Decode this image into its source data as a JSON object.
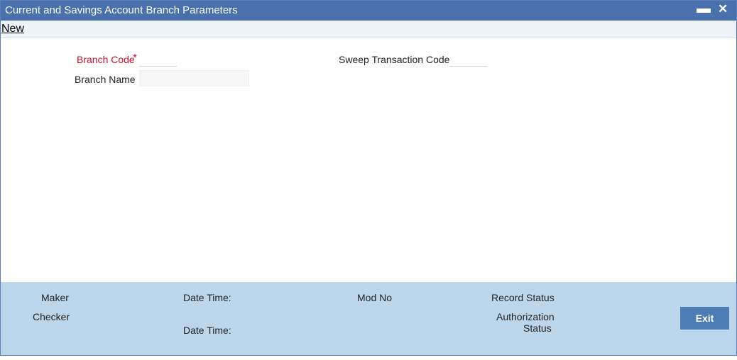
{
  "window": {
    "title": "Current and Savings Account Branch Parameters",
    "minimize_glyph": "▬",
    "close_glyph": "✕"
  },
  "toolbar": {
    "new_label": "New"
  },
  "form": {
    "branch_code_label": "Branch Code",
    "required_mark": "*",
    "branch_code_value": "",
    "branch_name_label": "Branch Name",
    "branch_name_value": "",
    "sweep_label": "Sweep Transaction Code",
    "sweep_value": ""
  },
  "footer": {
    "maker": "Maker",
    "checker": "Checker",
    "date_time_1": "Date Time:",
    "date_time_2": "Date Time:",
    "mod_no": "Mod No",
    "record_status": "Record Status",
    "auth_status_line1": "Authorization",
    "auth_status_line2": "Status",
    "exit_label": "Exit"
  },
  "colors": {
    "titlebar": "#4a70ad",
    "footer": "#bcd7ec",
    "exit_button": "#4d7db5",
    "required": "#c8102e"
  }
}
